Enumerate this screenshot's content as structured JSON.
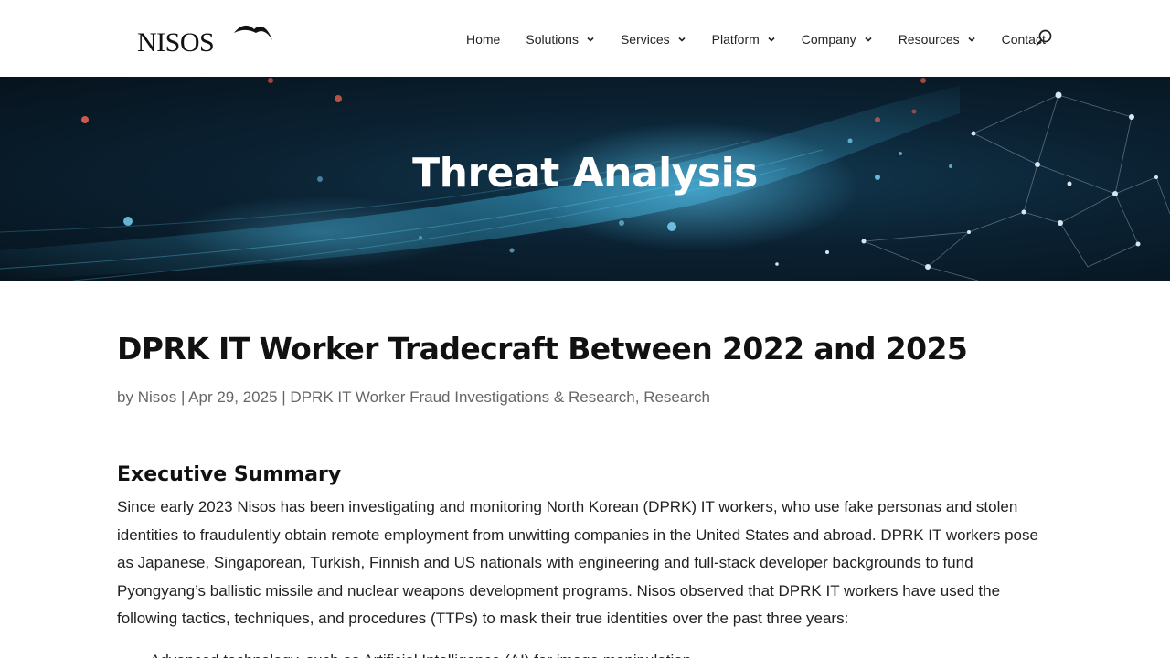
{
  "header": {
    "logo_text": "NISOS",
    "nav": [
      {
        "label": "Home",
        "has_dropdown": false
      },
      {
        "label": "Solutions",
        "has_dropdown": true
      },
      {
        "label": "Services",
        "has_dropdown": true
      },
      {
        "label": "Platform",
        "has_dropdown": true
      },
      {
        "label": "Company",
        "has_dropdown": true
      },
      {
        "label": "Resources",
        "has_dropdown": true
      },
      {
        "label": "Contact",
        "has_dropdown": false
      }
    ],
    "search_icon": "search-icon"
  },
  "hero": {
    "title": "Threat Analysis"
  },
  "article": {
    "title": "DPRK IT Worker Tradecraft Between 2022 and 2025",
    "meta": {
      "by": "by",
      "author": "Nisos",
      "sep1": "|",
      "date": "Apr 29, 2025",
      "sep2": "|",
      "category1": "DPRK IT Worker Fraud Investigations & Research",
      "comma": ",",
      "category2": "Research"
    },
    "section_heading": "Executive Summary",
    "paragraph": "Since early 2023 Nisos has been investigating and monitoring North Korean (DPRK) IT workers, who use fake personas and stolen identities to fraudulently obtain remote employment from unwitting companies in the United States and abroad. DPRK IT workers pose as Japanese, Singaporean, Turkish, Finnish and US nationals with engineering and full-stack developer backgrounds to fund Pyongyang’s ballistic missile and nuclear weapons development programs. Nisos observed that DPRK IT workers have used the following tactics, techniques, and procedures (TTPs) to mask their true identities over the past three years:",
    "bullets": [
      "Advanced technology, such as Artificial Intelligence (AI) for image manipulation"
    ]
  },
  "colors": {
    "hero_dark": "#06131d",
    "hero_mid": "#123a52",
    "accent_cyan": "#4fc3e8",
    "text": "#222222",
    "meta": "#666666"
  }
}
